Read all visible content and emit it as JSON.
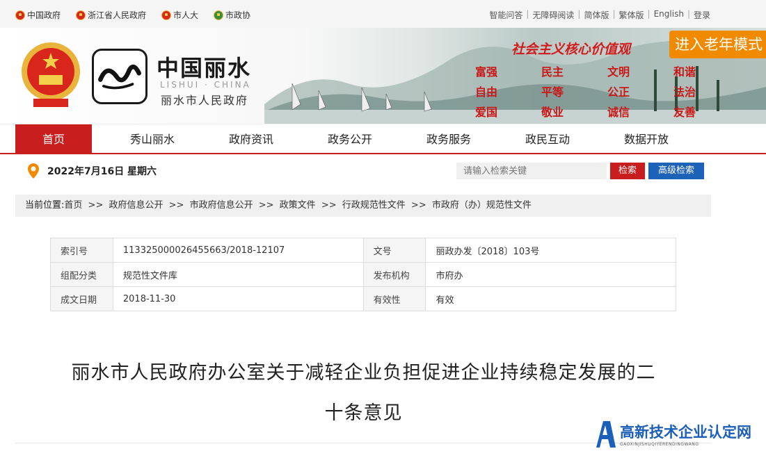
{
  "topbar": {
    "links": [
      {
        "label": "中国政府",
        "icon": "national-emblem-icon"
      },
      {
        "label": "浙江省人民政府",
        "icon": "national-emblem-icon"
      },
      {
        "label": "市人大",
        "icon": "national-emblem-icon"
      },
      {
        "label": "市政协",
        "icon": "cppcc-emblem-icon"
      }
    ],
    "right": [
      "智能问答",
      "无障碍阅读",
      "简体版",
      "繁体版",
      "English",
      "登录"
    ]
  },
  "header": {
    "title": "中国丽水",
    "subtitle": "LISHUI · CHINA",
    "org": "丽水市人民政府",
    "slogan": "社会主义核心价值观",
    "elder_mode": "进入老年模式",
    "values": [
      "富强",
      "民主",
      "文明",
      "和谐",
      "自由",
      "平等",
      "公正",
      "法治",
      "爱国",
      "敬业",
      "诚信",
      "友善"
    ]
  },
  "nav": {
    "items": [
      "首页",
      "秀山丽水",
      "政府资讯",
      "政务公开",
      "政务服务",
      "政民互动",
      "数据开放"
    ],
    "active": 0
  },
  "date": "2022年7月16日 星期六",
  "search": {
    "placeholder": "请输入检索关键",
    "button": "检索",
    "advanced": "高级检索"
  },
  "breadcrumb": {
    "label": "当前位置:",
    "items": [
      "首页",
      "政府信息公开",
      "市政府信息公开",
      "政策文件",
      "行政规范性文件",
      "市政府（办）规范性文件"
    ],
    "separator": ">>"
  },
  "meta": [
    [
      {
        "k": "索引号",
        "v": "113325000026455663/2018-12107"
      },
      {
        "k": "文号",
        "v": "丽政办发〔2018〕103号"
      }
    ],
    [
      {
        "k": "组配分类",
        "v": "规范性文件库"
      },
      {
        "k": "发布机构",
        "v": "市府办"
      }
    ],
    [
      {
        "k": "成文日期",
        "v": "2018-11-30"
      },
      {
        "k": "有效性",
        "v": "有效"
      }
    ]
  ],
  "document": {
    "title_line1": "丽水市人民政府办公室关于减轻企业负担促进企业持续稳定发展的二",
    "title_line2": "十条意见"
  },
  "watermark": {
    "main": "高新技术企业认定网",
    "sub": "GAOXINJISHUQIYERENDINGWANG"
  },
  "colors": {
    "brand_red": "#c81e1e",
    "search_blue": "#1c62b8",
    "elder_orange": "#f08a00"
  }
}
